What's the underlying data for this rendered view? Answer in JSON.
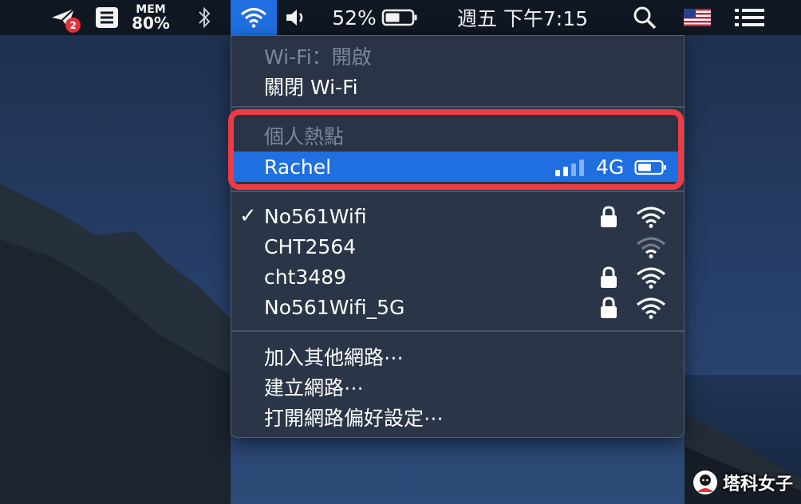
{
  "menubar": {
    "notification_badge": "2",
    "mem_label": "MEM",
    "mem_value": "80%",
    "battery_percent": "52%",
    "clock": "週五 下午7:15"
  },
  "wifi_menu": {
    "status": "Wi-Fi：開啟",
    "toggle_label": "關閉 Wi-Fi",
    "hotspot_header": "個人熱點",
    "hotspot": {
      "name": "Rachel",
      "network_type": "4G",
      "signal_bars": 2,
      "signal_bars_total": 4
    },
    "networks": [
      {
        "name": "No561Wifi",
        "connected": true,
        "locked": true,
        "signal": 3
      },
      {
        "name": "CHT2564",
        "connected": false,
        "locked": false,
        "signal": 1
      },
      {
        "name": "cht3489",
        "connected": false,
        "locked": true,
        "signal": 3
      },
      {
        "name": "No561Wifi_5G",
        "connected": false,
        "locked": true,
        "signal": 3
      }
    ],
    "join_other": "加入其他網路⋯",
    "create_network": "建立網路⋯",
    "open_preferences": "打開網路偏好設定⋯"
  },
  "watermark": "塔科女子",
  "colors": {
    "selection": "#1f6fe0",
    "highlight_box": "#ef3b44",
    "menubar": "#0f1722"
  }
}
